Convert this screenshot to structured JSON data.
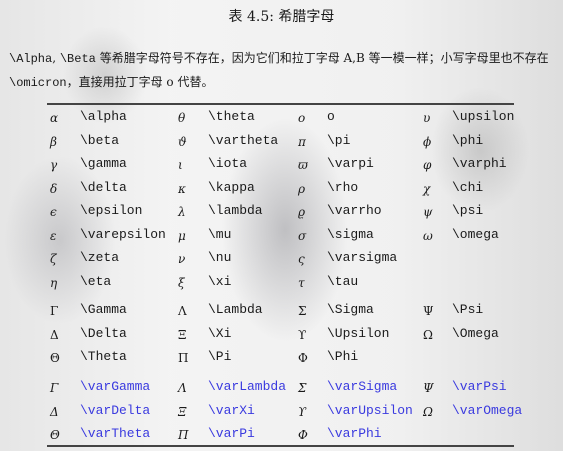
{
  "caption": "表 4.5: 希腊字母",
  "paragraph": {
    "line1_cmd1": "\\Alpha",
    "line1_sep": ", ",
    "line1_cmd2": "\\Beta",
    "line1_text": " 等希腊字母符号不存在，因为它们和拉丁字母 A,B 等一模一样；小写字母里也不存在",
    "line2_cmd": "\\omicron",
    "line2_text": "，直接用拉丁字母 o 代替。"
  },
  "colors": {
    "var_command": "#3a3adf",
    "text": "#1a1a1a"
  },
  "groups": [
    {
      "style": "lower",
      "rows": [
        [
          [
            "α",
            "\\alpha"
          ],
          [
            "θ",
            "\\theta"
          ],
          [
            "o",
            "o"
          ],
          [
            "υ",
            "\\upsilon"
          ]
        ],
        [
          [
            "β",
            "\\beta"
          ],
          [
            "ϑ",
            "\\vartheta"
          ],
          [
            "π",
            "\\pi"
          ],
          [
            "ϕ",
            "\\phi"
          ]
        ],
        [
          [
            "γ",
            "\\gamma"
          ],
          [
            "ι",
            "\\iota"
          ],
          [
            "ϖ",
            "\\varpi"
          ],
          [
            "φ",
            "\\varphi"
          ]
        ],
        [
          [
            "δ",
            "\\delta"
          ],
          [
            "κ",
            "\\kappa"
          ],
          [
            "ρ",
            "\\rho"
          ],
          [
            "χ",
            "\\chi"
          ]
        ],
        [
          [
            "ϵ",
            "\\epsilon"
          ],
          [
            "λ",
            "\\lambda"
          ],
          [
            "ϱ",
            "\\varrho"
          ],
          [
            "ψ",
            "\\psi"
          ]
        ],
        [
          [
            "ε",
            "\\varepsilon"
          ],
          [
            "μ",
            "\\mu"
          ],
          [
            "σ",
            "\\sigma"
          ],
          [
            "ω",
            "\\omega"
          ]
        ],
        [
          [
            "ζ",
            "\\zeta"
          ],
          [
            "ν",
            "\\nu"
          ],
          [
            "ς",
            "\\varsigma"
          ],
          null
        ],
        [
          [
            "η",
            "\\eta"
          ],
          [
            "ξ",
            "\\xi"
          ],
          [
            "τ",
            "\\tau"
          ],
          null
        ]
      ]
    },
    {
      "style": "upper",
      "rows": [
        [
          [
            "Γ",
            "\\Gamma"
          ],
          [
            "Λ",
            "\\Lambda"
          ],
          [
            "Σ",
            "\\Sigma"
          ],
          [
            "Ψ",
            "\\Psi"
          ]
        ],
        [
          [
            "Δ",
            "\\Delta"
          ],
          [
            "Ξ",
            "\\Xi"
          ],
          [
            "ϒ",
            "\\Upsilon"
          ],
          [
            "Ω",
            "\\Omega"
          ]
        ],
        [
          [
            "Θ",
            "\\Theta"
          ],
          [
            "Π",
            "\\Pi"
          ],
          [
            "Φ",
            "\\Phi"
          ],
          null
        ]
      ]
    },
    {
      "style": "var",
      "rows": [
        [
          [
            "Γ",
            "\\varGamma"
          ],
          [
            "Λ",
            "\\varLambda"
          ],
          [
            "Σ",
            "\\varSigma"
          ],
          [
            "Ψ",
            "\\varPsi"
          ]
        ],
        [
          [
            "Δ",
            "\\varDelta"
          ],
          [
            "Ξ",
            "\\varXi"
          ],
          [
            "ϒ",
            "\\varUpsilon"
          ],
          [
            "Ω",
            "\\varOmega"
          ]
        ],
        [
          [
            "Θ",
            "\\varTheta"
          ],
          [
            "Π",
            "\\varPi"
          ],
          [
            "Φ",
            "\\varPhi"
          ],
          null
        ]
      ]
    }
  ]
}
